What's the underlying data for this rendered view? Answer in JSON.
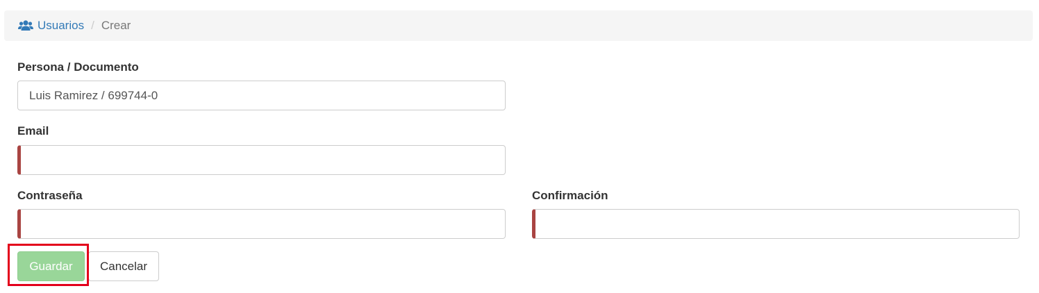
{
  "breadcrumb": {
    "icon": "users-icon",
    "link_label": "Usuarios",
    "separator": "/",
    "current": "Crear",
    "link_color": "#337ab7"
  },
  "form": {
    "persona": {
      "label": "Persona / Documento",
      "value": "Luis Ramirez / 699744-0"
    },
    "email": {
      "label": "Email",
      "value": ""
    },
    "password": {
      "label": "Contraseña",
      "value": ""
    },
    "confirmation": {
      "label": "Confirmación",
      "value": ""
    },
    "required_indicator_color": "#a94442"
  },
  "actions": {
    "save_label": "Guardar",
    "cancel_label": "Cancelar",
    "save_color": "#99d699",
    "highlight_color": "#e3001b"
  }
}
